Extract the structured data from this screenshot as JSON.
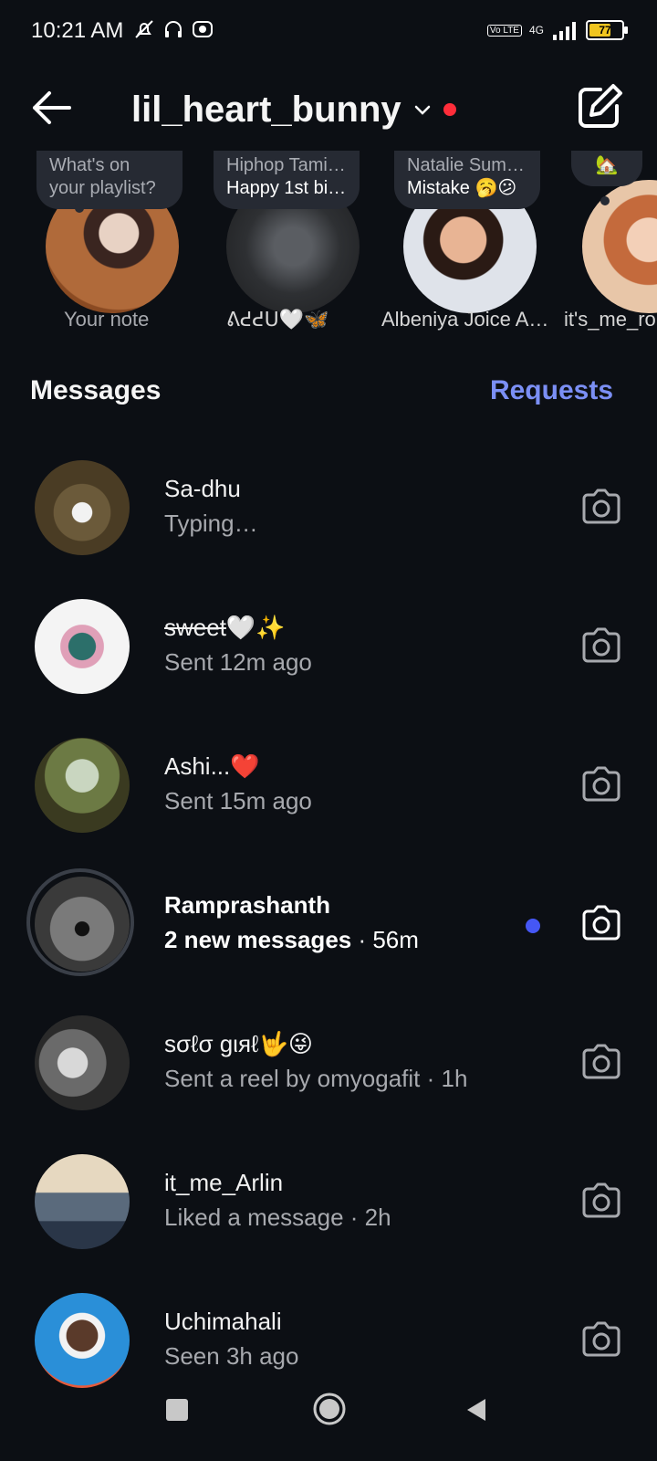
{
  "status": {
    "time": "10:21 AM",
    "network": "4G",
    "volte": "Vo LTE",
    "battery": "77",
    "battery_level": 0.77,
    "icons": [
      "mute-bell-icon",
      "headset-icon",
      "cast-icon",
      "signal-icon"
    ]
  },
  "header": {
    "username": "lil_heart_bunny",
    "icons": [
      "back-arrow-icon",
      "chevron-down-icon",
      "compose-icon"
    ]
  },
  "notes": [
    {
      "bubble_line1": "What's on",
      "bubble_line2": "your playlist?",
      "name": "Your note"
    },
    {
      "bubble_line1": "Hiphop Tami…",
      "bubble_line2": "Happy 1st bi…",
      "name": "ᕕᕍᕍᑌ🤍🦋"
    },
    {
      "bubble_line1": "Natalie Sum…",
      "bubble_line2": "Mistake 🥱😕",
      "name": "Albeniya Joice A…"
    },
    {
      "bubble_line1": "🏡",
      "bubble_line2": "",
      "name": "it's_me_ro"
    }
  ],
  "section": {
    "messages_label": "Messages",
    "requests_label": "Requests"
  },
  "threads": [
    {
      "name": "Sa-dhu",
      "subtitle": "Typing…"
    },
    {
      "name": "sweet",
      "name_suffix": "🤍✨",
      "subtitle": "Sent 12m ago"
    },
    {
      "name": "Ashi...❤️",
      "subtitle": "Sent 15m ago"
    },
    {
      "name": "Ramprashanth",
      "subtitle_bold": "2 new messages",
      "subtitle_rest": " · 56m"
    },
    {
      "name": "sσℓσ gιяℓ🤟😜",
      "subtitle": "Sent a reel by omyogafit · 1h"
    },
    {
      "name": "it_me_Arlin",
      "subtitle": "Liked a message · 2h"
    },
    {
      "name": "Uchimahali",
      "subtitle": "Seen 3h ago"
    }
  ],
  "navbar": {
    "icons": [
      "recents-square-icon",
      "home-circle-icon",
      "back-triangle-icon"
    ]
  },
  "colors": {
    "background": "#0c0f14",
    "accent": "#7b8ff5",
    "unread_dot": "#4557f5",
    "live_dot": "#ff2d3a"
  }
}
